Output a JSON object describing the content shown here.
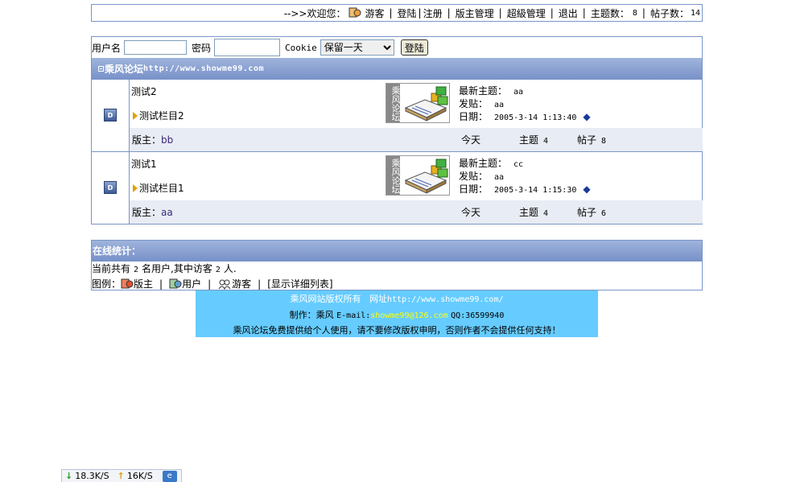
{
  "topbar": {
    "prefix": "-->>欢迎您：",
    "guest_icon": "guest-icon",
    "guest": "游客",
    "login": "登陆",
    "register": "注册",
    "board_admin": "版主管理",
    "super_admin": "超級管理",
    "logout": "退出",
    "topics_label": "主题数：",
    "topics_value": "8",
    "posts_label": "帖子数：",
    "posts_value": "14"
  },
  "login_form": {
    "username_label": "用户名",
    "password_label": "密码",
    "cookie_label": "Cookie",
    "cookie_selected": "保留一天",
    "submit_label": "登陆"
  },
  "forum": {
    "name": "乘风论坛",
    "url": "http://www.showme99.com"
  },
  "boards": [
    {
      "name": "测试2",
      "subforum": "测试栏目2",
      "logo_text": "乘风论坛",
      "latest_label": "最新主题：",
      "latest_value": "aa",
      "poster_label": "发贴：",
      "poster_value": "aa",
      "date_label": "日期：",
      "date_value": "2005-3-14 1:13:40",
      "moderator_label": "版主：",
      "moderator_value": "bb",
      "today_label": "今天",
      "topics_label": "主题",
      "topics_value": "4",
      "posts_label": "帖子",
      "posts_value": "8"
    },
    {
      "name": "测试1",
      "subforum": "测试栏目1",
      "logo_text": "乘风论坛",
      "latest_label": "最新主题：",
      "latest_value": "cc",
      "poster_label": "发贴：",
      "poster_value": "aa",
      "date_label": "日期：",
      "date_value": "2005-3-14 1:15:30",
      "moderator_label": "版主：",
      "moderator_value": "aa",
      "today_label": "今天",
      "topics_label": "主题",
      "topics_value": "4",
      "posts_label": "帖子",
      "posts_value": "6"
    }
  ],
  "online": {
    "title": "在线统计：",
    "line_prefix": "当前共有",
    "users_count": "2",
    "line_mid": "名用户,其中访客",
    "guests_count": "2",
    "line_suffix": "人.",
    "legend_label": "图例：",
    "legend_moderator": "版主",
    "legend_user": "用户",
    "legend_guest": "游客",
    "show_detail": "[显示详细列表]"
  },
  "footer": {
    "copyright": "乘风网站版权所有",
    "site_label": "网址",
    "site_url": "http://www.showme99.com/",
    "author_label": "制作：乘风",
    "email_label": "E-mail:",
    "email": "showme99@126.com",
    "qq": "QQ:36599940",
    "notice": "乘风论坛免费提供给个人使用，请不要修改版权申明，否则作者不会提供任何支持！"
  },
  "speed": {
    "down": "18.3K/S",
    "up": "16K/S"
  },
  "colors": {
    "border": "#7a96c8",
    "band": "#7891c8",
    "footer_bg": "#66ccff",
    "email": "#ffff00"
  }
}
